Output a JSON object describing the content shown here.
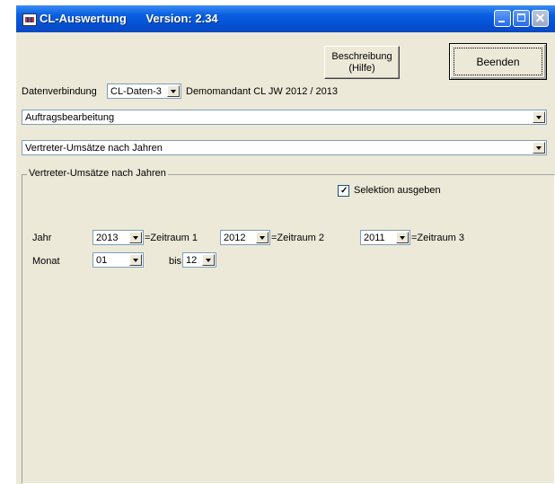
{
  "window": {
    "title": "CL-Auswertung",
    "version_label": "Version: 2.34"
  },
  "buttons": {
    "help_line1": "Beschreibung",
    "help_line2": "(Hilfe)",
    "exit": "Beenden"
  },
  "connection": {
    "label": "Datenverbindung",
    "value": "CL-Daten-3",
    "client": "Demomandant CL JW 2012 / 2013"
  },
  "module_select": {
    "value": "Auftragsbearbeitung"
  },
  "report_select": {
    "value": "Vertreter-Umsätze nach Jahren"
  },
  "group": {
    "title": "Vertreter-Umsätze nach Jahren",
    "selection_checkbox_label": "Selektion ausgeben",
    "selection_checked": true,
    "year_label": "Jahr",
    "month_label": "Monat",
    "periods": [
      {
        "year": "2013",
        "label": "=Zeitraum 1"
      },
      {
        "year": "2012",
        "label": "=Zeitraum 2"
      },
      {
        "year": "2011",
        "label": "=Zeitraum 3"
      }
    ],
    "month_from": "01",
    "month_to_label": "bis",
    "month_to": "12"
  },
  "colors": {
    "title_bar": "#0451d4",
    "window_bg": "#ece9d8",
    "field_border": "#7f9db9"
  }
}
